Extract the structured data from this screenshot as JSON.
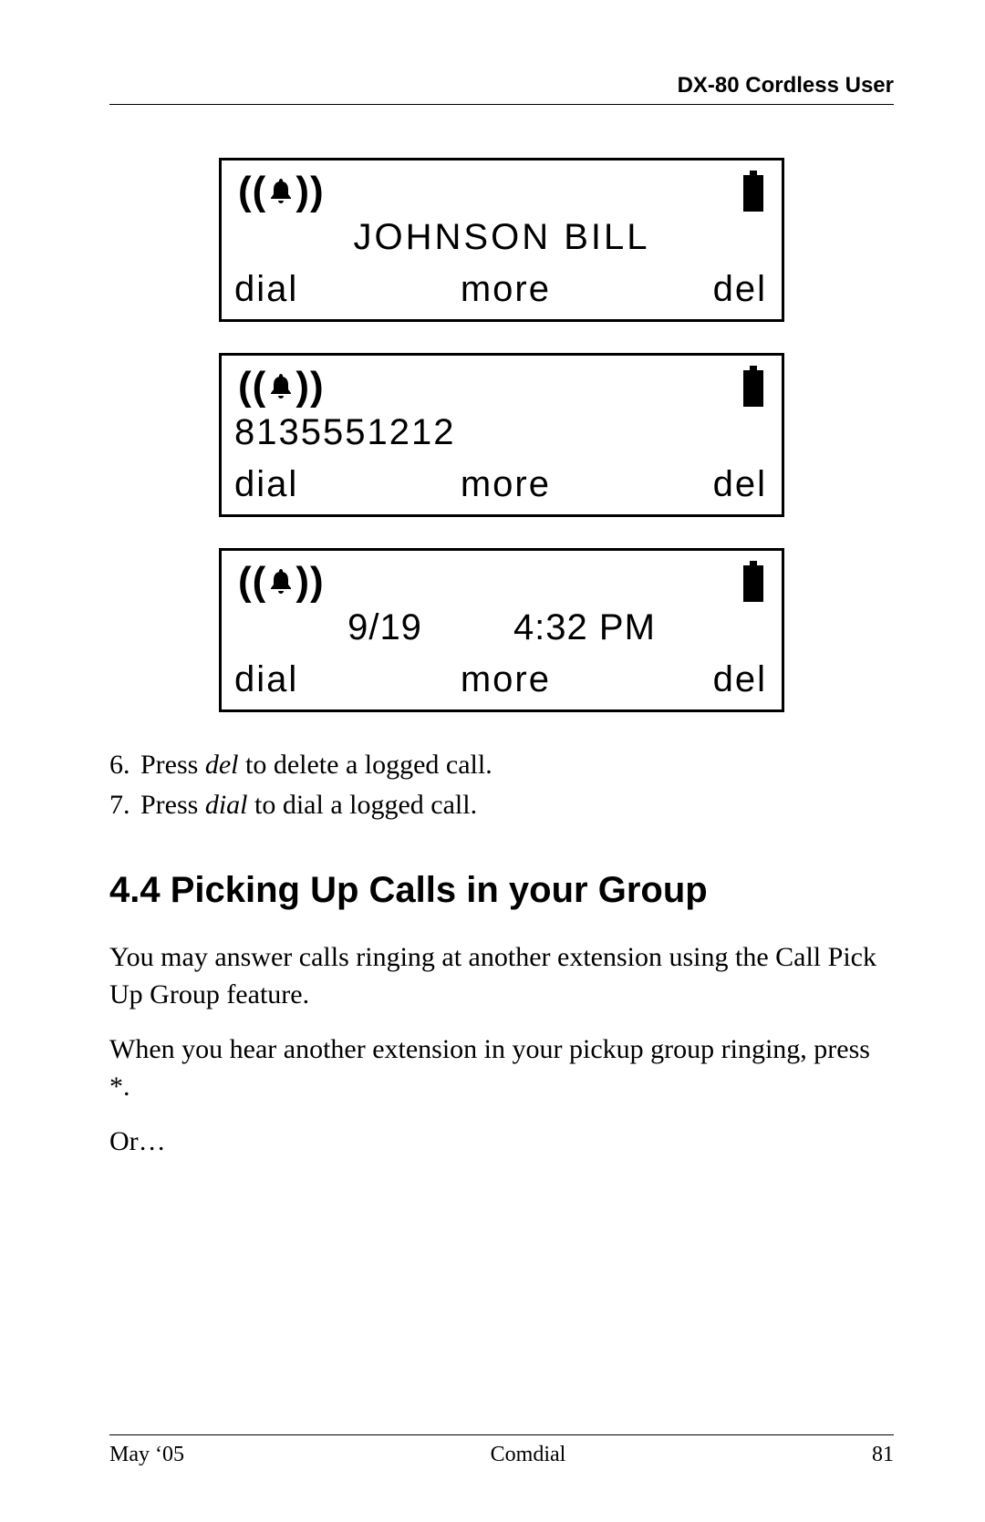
{
  "header": {
    "title": "DX-80 Cordless User"
  },
  "lcd": [
    {
      "main": "JOHNSON BILL",
      "align": "center",
      "soft": {
        "left": "dial",
        "center": "more",
        "right": "del"
      }
    },
    {
      "main": "8135551212",
      "align": "left",
      "soft": {
        "left": "dial",
        "center": "more",
        "right": "del"
      }
    },
    {
      "date": "9/19",
      "time": "4:32 PM",
      "align": "datetime",
      "soft": {
        "left": "dial",
        "center": "more",
        "right": "del"
      }
    }
  ],
  "steps": {
    "s6_num": "6.",
    "s6_a": "Press ",
    "s6_em": "del",
    "s6_b": " to delete a logged call.",
    "s7_num": "7.",
    "s7_a": "Press ",
    "s7_em": "dial",
    "s7_b": " to dial a logged call."
  },
  "section": {
    "heading": "4.4  Picking Up Calls in your Group",
    "p1": "You may answer calls ringing at another extension using the Call Pick Up Group feature.",
    "p2": "When you hear another extension in your pickup group ringing, press *.",
    "p3": "Or…"
  },
  "footer": {
    "left": "May ‘05",
    "center": "Comdial",
    "right": "81"
  }
}
